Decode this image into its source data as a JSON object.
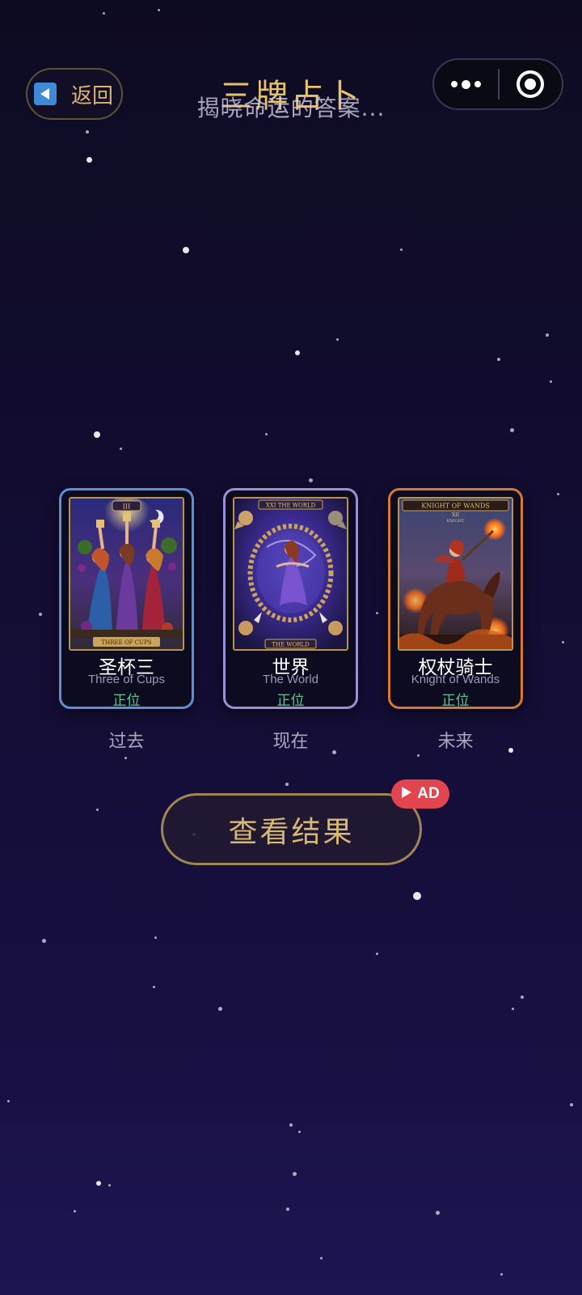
{
  "header": {
    "back_label": "返回",
    "title": "三牌占卜",
    "subtitle": "揭晓命运的答案..."
  },
  "capsule": {
    "more_icon": "more-dots-icon",
    "close_icon": "target-icon"
  },
  "cards": [
    {
      "name_cn": "圣杯三",
      "name_en": "Three of Cups",
      "orientation": "正位",
      "position": "过去",
      "art_header": "III",
      "art_footer": "THREE OF CUPS",
      "border_color": "#5b8fd6"
    },
    {
      "name_cn": "世界",
      "name_en": "The World",
      "orientation": "正位",
      "position": "现在",
      "art_header": "XXI THE WORLD",
      "art_footer": "THE WORLD",
      "border_color": "#9b8fd6"
    },
    {
      "name_cn": "权杖骑士",
      "name_en": "Knight of Wands",
      "orientation": "正位",
      "position": "未来",
      "art_header": "KNIGHT OF WANDS",
      "art_sub": "XII",
      "art_sub2": "KNIGHT",
      "border_color": "#d6782e"
    }
  ],
  "result_button": {
    "label": "查看结果",
    "badge_label": "AD",
    "badge_icon": "play-icon"
  },
  "colors": {
    "gold": "#d9b871",
    "green": "#5fc790",
    "ad_red": "#e2454e"
  }
}
